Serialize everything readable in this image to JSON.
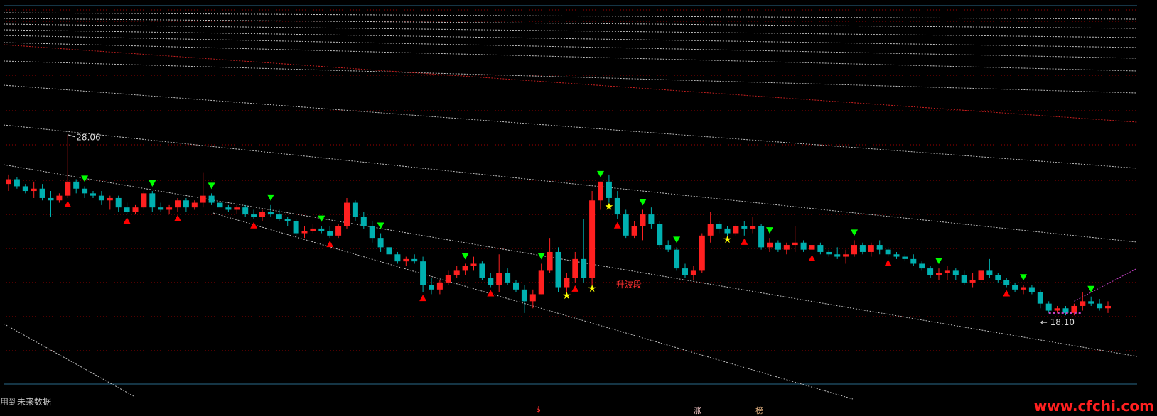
{
  "footer": {
    "note": "用到未来数据"
  },
  "watermark": "www.cfchi.com",
  "badges": [
    {
      "text": "$",
      "color": "#ff3030"
    },
    {
      "text": "涨",
      "color": "#ffd0d0"
    },
    {
      "text": "榜",
      "color": "#e0b080"
    }
  ],
  "colors": {
    "background": "#000000",
    "up": "#ff2020",
    "down": "#00b0b0",
    "grid": "#a00000",
    "channel": "#c0c0c0",
    "buy_marker": "#ff0000",
    "sell_marker": "#00ff00",
    "star": "#ffff00"
  },
  "chart_data": {
    "type": "candlestick",
    "high_label": "28.06",
    "low_label": "18.10",
    "annotation": "升波段",
    "ylim": [
      17.4,
      33.5
    ],
    "ohlc": [
      [
        25.9,
        26.3,
        25.6,
        26.1
      ],
      [
        26.1,
        26.2,
        25.7,
        25.8
      ],
      [
        25.8,
        25.9,
        25.5,
        25.6
      ],
      [
        25.6,
        26.0,
        25.3,
        25.7
      ],
      [
        25.7,
        25.9,
        25.2,
        25.3
      ],
      [
        25.3,
        25.6,
        24.5,
        25.2
      ],
      [
        25.2,
        25.5,
        25.1,
        25.4
      ],
      [
        25.4,
        28.0,
        25.3,
        26.0
      ],
      [
        26.0,
        26.1,
        25.5,
        25.7
      ],
      [
        25.7,
        25.8,
        25.3,
        25.5
      ],
      [
        25.5,
        25.6,
        25.3,
        25.4
      ],
      [
        25.4,
        25.6,
        25.0,
        25.2
      ],
      [
        25.2,
        25.4,
        24.8,
        25.3
      ],
      [
        25.3,
        25.4,
        24.7,
        24.9
      ],
      [
        24.9,
        25.1,
        24.6,
        24.7
      ],
      [
        24.7,
        25.0,
        24.6,
        24.9
      ],
      [
        24.9,
        25.6,
        24.8,
        25.5
      ],
      [
        25.5,
        25.6,
        24.7,
        24.9
      ],
      [
        24.9,
        25.1,
        24.7,
        24.8
      ],
      [
        24.8,
        25.0,
        24.6,
        24.9
      ],
      [
        24.9,
        25.3,
        24.7,
        25.2
      ],
      [
        25.2,
        25.3,
        24.7,
        24.9
      ],
      [
        24.9,
        25.2,
        24.8,
        25.1
      ],
      [
        25.1,
        26.4,
        24.9,
        25.4
      ],
      [
        25.4,
        25.5,
        25.0,
        25.1
      ],
      [
        25.1,
        25.2,
        24.9,
        24.9
      ],
      [
        24.9,
        25.0,
        24.7,
        24.8
      ],
      [
        24.8,
        25.0,
        24.6,
        24.9
      ],
      [
        24.9,
        25.0,
        24.5,
        24.6
      ],
      [
        24.6,
        24.8,
        24.4,
        24.5
      ],
      [
        24.5,
        24.8,
        24.3,
        24.7
      ],
      [
        24.7,
        25.0,
        24.5,
        24.6
      ],
      [
        24.6,
        24.8,
        24.3,
        24.4
      ],
      [
        24.4,
        24.5,
        24.1,
        24.3
      ],
      [
        24.3,
        24.4,
        23.7,
        23.8
      ],
      [
        23.8,
        24.1,
        23.6,
        23.9
      ],
      [
        23.9,
        24.2,
        23.8,
        24.0
      ],
      [
        24.0,
        24.1,
        23.8,
        23.9
      ],
      [
        23.9,
        24.1,
        23.6,
        23.7
      ],
      [
        23.7,
        24.2,
        23.6,
        24.1
      ],
      [
        24.1,
        25.3,
        24.0,
        25.1
      ],
      [
        25.1,
        25.2,
        24.3,
        24.5
      ],
      [
        24.5,
        24.7,
        24.0,
        24.1
      ],
      [
        24.1,
        24.3,
        23.4,
        23.6
      ],
      [
        23.6,
        23.8,
        23.0,
        23.2
      ],
      [
        23.2,
        23.4,
        22.8,
        22.9
      ],
      [
        22.9,
        23.0,
        22.5,
        22.6
      ],
      [
        22.6,
        22.8,
        22.4,
        22.7
      ],
      [
        22.7,
        22.9,
        22.5,
        22.6
      ],
      [
        22.6,
        22.8,
        21.3,
        21.6
      ],
      [
        21.6,
        21.9,
        21.2,
        21.4
      ],
      [
        21.4,
        21.8,
        21.2,
        21.7
      ],
      [
        21.7,
        22.2,
        21.6,
        22.0
      ],
      [
        22.0,
        22.4,
        21.9,
        22.2
      ],
      [
        22.2,
        22.5,
        22.0,
        22.4
      ],
      [
        22.4,
        22.8,
        22.2,
        22.5
      ],
      [
        22.5,
        22.6,
        21.8,
        21.9
      ],
      [
        21.9,
        22.1,
        21.5,
        21.6
      ],
      [
        21.6,
        22.9,
        21.3,
        22.1
      ],
      [
        22.1,
        22.3,
        21.6,
        21.7
      ],
      [
        21.7,
        21.8,
        21.3,
        21.4
      ],
      [
        21.4,
        21.6,
        20.4,
        20.9
      ],
      [
        20.9,
        21.4,
        20.6,
        21.2
      ],
      [
        21.2,
        22.5,
        21.2,
        22.2
      ],
      [
        22.2,
        23.6,
        22.1,
        23.0
      ],
      [
        23.0,
        23.2,
        21.3,
        21.5
      ],
      [
        21.5,
        22.1,
        21.3,
        21.9
      ],
      [
        21.9,
        23.0,
        21.7,
        22.7
      ],
      [
        22.7,
        24.4,
        21.7,
        21.9
      ],
      [
        21.9,
        25.6,
        21.6,
        25.2
      ],
      [
        25.2,
        26.0,
        24.8,
        26.0
      ],
      [
        26.0,
        26.3,
        25.1,
        25.3
      ],
      [
        25.3,
        25.6,
        24.4,
        24.6
      ],
      [
        24.6,
        24.8,
        23.6,
        23.7
      ],
      [
        23.7,
        24.3,
        23.6,
        24.1
      ],
      [
        24.1,
        24.8,
        23.5,
        24.6
      ],
      [
        24.6,
        24.9,
        24.0,
        24.2
      ],
      [
        24.2,
        24.3,
        23.2,
        23.3
      ],
      [
        23.3,
        23.5,
        23.0,
        23.1
      ],
      [
        23.1,
        23.2,
        22.2,
        22.3
      ],
      [
        22.3,
        22.5,
        21.9,
        22.0
      ],
      [
        22.0,
        22.4,
        21.8,
        22.2
      ],
      [
        22.2,
        23.8,
        22.1,
        23.7
      ],
      [
        23.7,
        24.7,
        23.4,
        24.2
      ],
      [
        24.2,
        24.3,
        23.8,
        24.0
      ],
      [
        24.0,
        24.1,
        23.7,
        23.8
      ],
      [
        23.8,
        24.2,
        23.7,
        24.1
      ],
      [
        24.1,
        24.3,
        23.7,
        24.0
      ],
      [
        24.0,
        24.5,
        23.8,
        24.1
      ],
      [
        24.1,
        24.2,
        23.1,
        23.2
      ],
      [
        23.2,
        23.6,
        23.0,
        23.4
      ],
      [
        23.4,
        23.5,
        23.0,
        23.1
      ],
      [
        23.1,
        23.4,
        22.9,
        23.3
      ],
      [
        23.3,
        24.1,
        23.0,
        23.4
      ],
      [
        23.4,
        23.5,
        23.0,
        23.1
      ],
      [
        23.1,
        23.6,
        23.0,
        23.3
      ],
      [
        23.3,
        23.4,
        22.9,
        23.0
      ],
      [
        23.0,
        23.1,
        22.8,
        22.9
      ],
      [
        22.9,
        23.2,
        22.7,
        22.8
      ],
      [
        22.8,
        23.1,
        22.5,
        22.9
      ],
      [
        22.9,
        23.5,
        22.8,
        23.3
      ],
      [
        23.3,
        23.4,
        22.9,
        23.0
      ],
      [
        23.0,
        23.4,
        22.8,
        23.3
      ],
      [
        23.3,
        23.5,
        22.9,
        23.1
      ],
      [
        23.1,
        23.2,
        22.8,
        22.9
      ],
      [
        22.9,
        23.0,
        22.7,
        22.8
      ],
      [
        22.8,
        22.9,
        22.6,
        22.7
      ],
      [
        22.7,
        22.9,
        22.4,
        22.5
      ],
      [
        22.5,
        22.6,
        22.2,
        22.3
      ],
      [
        22.3,
        22.4,
        21.9,
        22.0
      ],
      [
        22.0,
        22.3,
        21.8,
        22.1
      ],
      [
        22.1,
        22.4,
        21.8,
        22.2
      ],
      [
        22.2,
        22.3,
        21.8,
        22.0
      ],
      [
        22.0,
        22.2,
        21.6,
        21.7
      ],
      [
        21.7,
        22.1,
        21.5,
        21.8
      ],
      [
        21.8,
        22.3,
        21.6,
        22.2
      ],
      [
        22.2,
        22.7,
        21.9,
        22.0
      ],
      [
        22.0,
        22.1,
        21.7,
        21.8
      ],
      [
        21.8,
        21.9,
        21.5,
        21.6
      ],
      [
        21.6,
        21.7,
        21.3,
        21.4
      ],
      [
        21.4,
        21.6,
        21.2,
        21.5
      ],
      [
        21.5,
        21.6,
        21.2,
        21.3
      ],
      [
        21.3,
        21.4,
        20.6,
        20.8
      ],
      [
        20.8,
        20.9,
        20.4,
        20.5
      ],
      [
        20.5,
        20.7,
        20.4,
        20.6
      ],
      [
        20.6,
        20.7,
        20.3,
        20.4
      ],
      [
        20.4,
        20.8,
        20.3,
        20.7
      ],
      [
        20.7,
        21.3,
        20.5,
        20.9
      ],
      [
        20.9,
        21.1,
        20.7,
        20.8
      ],
      [
        20.8,
        21.0,
        20.5,
        20.6
      ],
      [
        20.6,
        20.9,
        20.4,
        20.7
      ]
    ],
    "buy_marker_bars": [
      7,
      14,
      20,
      29,
      38,
      49,
      57,
      67,
      72,
      87,
      95,
      104,
      118
    ],
    "sell_marker_bars": [
      9,
      17,
      24,
      31,
      37,
      44,
      54,
      63,
      70,
      75,
      79,
      90,
      100,
      110,
      120,
      128,
      133
    ],
    "star_bars": [
      66,
      69,
      71,
      85
    ]
  }
}
